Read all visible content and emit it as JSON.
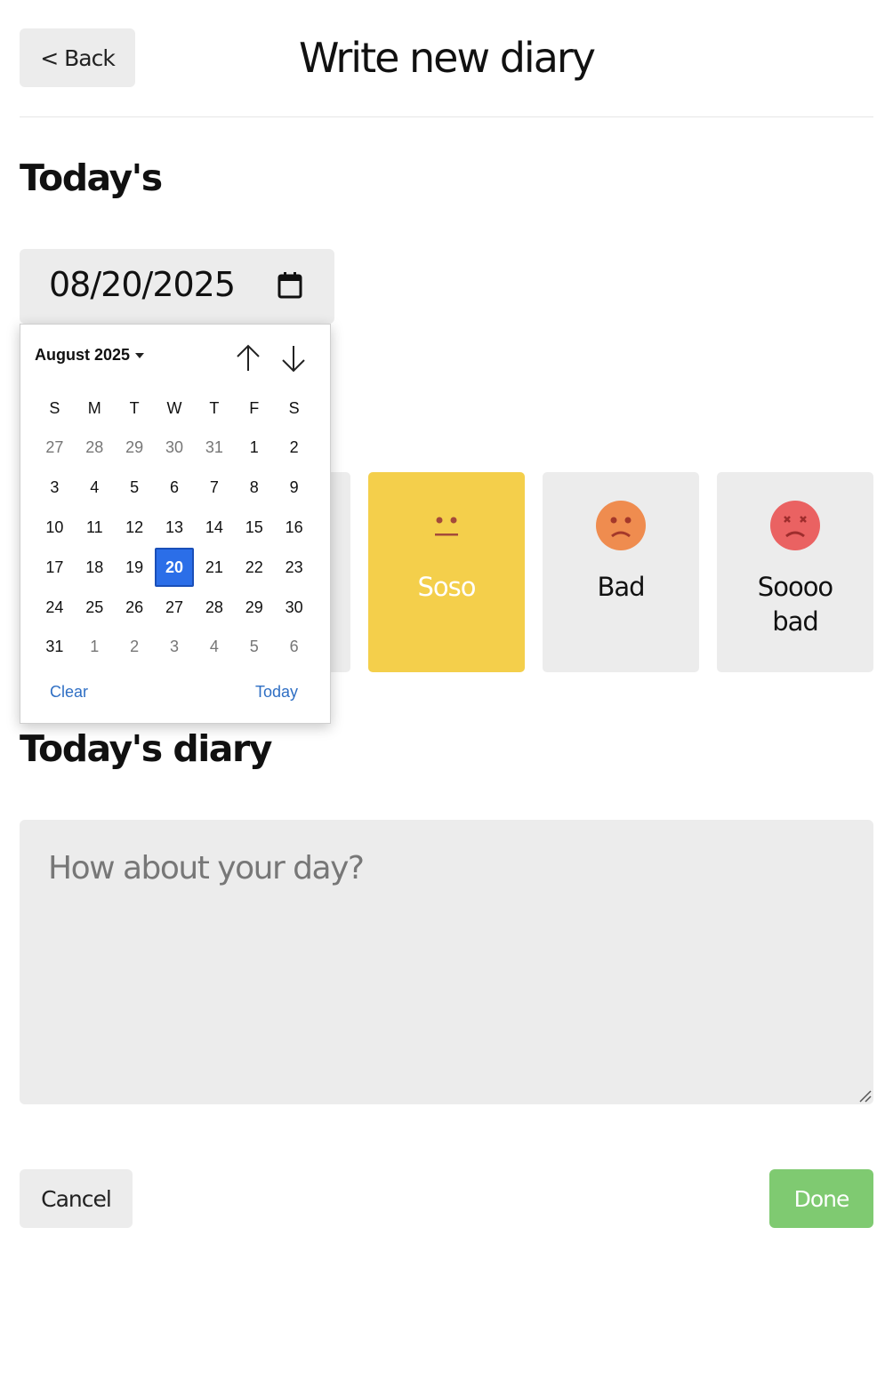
{
  "header": {
    "back_label": "< Back",
    "title": "Write new diary"
  },
  "date_section": {
    "title": "Today's",
    "value": "08/20/2025"
  },
  "calendar": {
    "month_label": "August 2025",
    "weekdays": [
      "S",
      "M",
      "T",
      "W",
      "T",
      "F",
      "S"
    ],
    "weeks": [
      [
        "27",
        "28",
        "29",
        "30",
        "31",
        "1",
        "2"
      ],
      [
        "3",
        "4",
        "5",
        "6",
        "7",
        "8",
        "9"
      ],
      [
        "10",
        "11",
        "12",
        "13",
        "14",
        "15",
        "16"
      ],
      [
        "17",
        "18",
        "19",
        "20",
        "21",
        "22",
        "23"
      ],
      [
        "24",
        "25",
        "26",
        "27",
        "28",
        "29",
        "30"
      ],
      [
        "31",
        "1",
        "2",
        "3",
        "4",
        "5",
        "6"
      ]
    ],
    "selected_day": "20",
    "clear_label": "Clear",
    "today_label": "Today"
  },
  "emotions": [
    {
      "label": "",
      "color": "#ececec"
    },
    {
      "label": "",
      "color": "#ececec"
    },
    {
      "label": "Soso",
      "color": "#f4cf4b",
      "face_color": "#f4cf4b",
      "selected": true
    },
    {
      "label": "Bad",
      "color": "#ececec",
      "face_color": "#ef8c4f"
    },
    {
      "label": "Soooo bad",
      "color": "#ececec",
      "face_color": "#ea6262"
    }
  ],
  "diary": {
    "title": "Today's diary",
    "placeholder": "How about your day?"
  },
  "footer": {
    "cancel_label": "Cancel",
    "done_label": "Done"
  },
  "colors": {
    "selected_day": "#2b6ee8",
    "link": "#2f6fc4",
    "done": "#7fca71",
    "soso": "#f4cf4b"
  }
}
